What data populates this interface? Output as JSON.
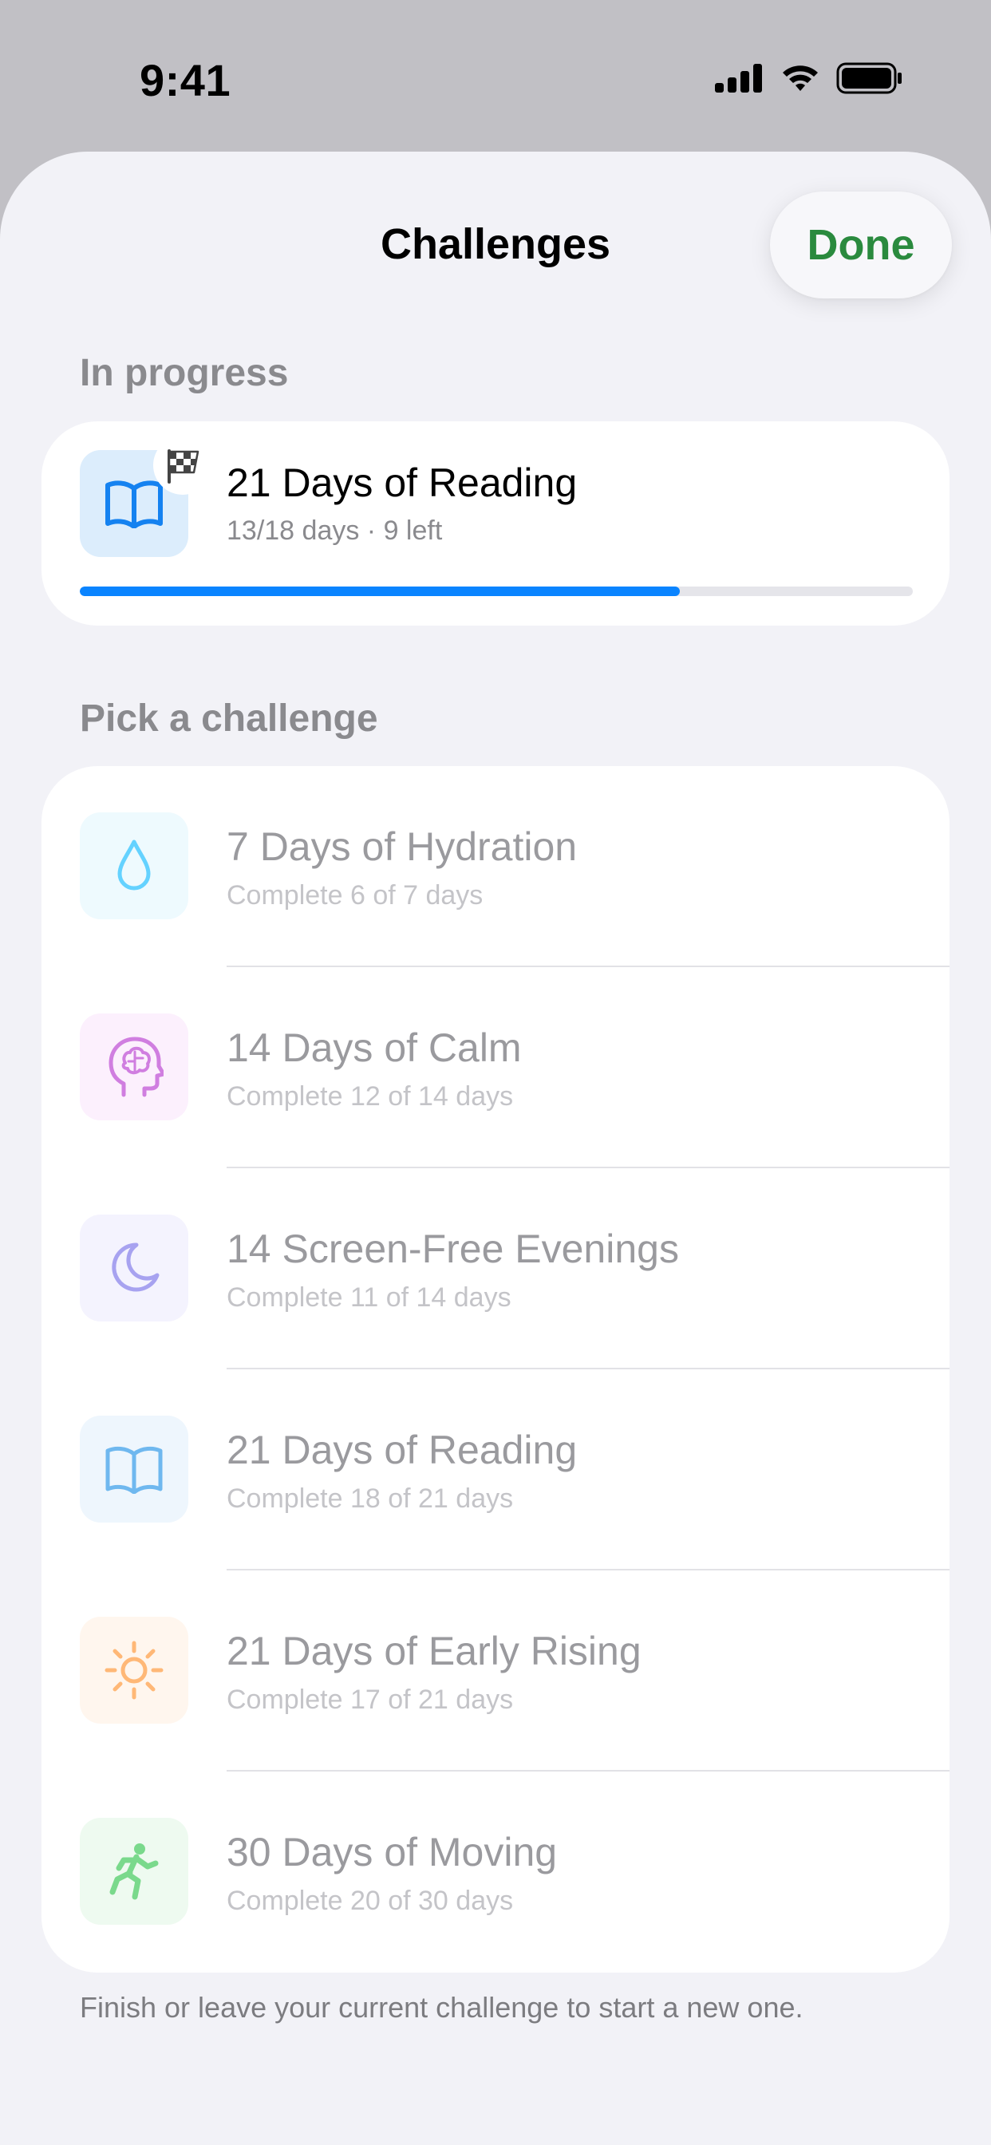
{
  "status_bar": {
    "time": "9:41"
  },
  "sheet": {
    "title": "Challenges",
    "done_label": "Done"
  },
  "in_progress": {
    "header": "In progress",
    "challenge": {
      "title": "21 Days of Reading",
      "subtitle": "13/18 days · 9 left",
      "progress_fraction": 0.72,
      "icon": "book-icon",
      "badge_icon": "checkered-flag-icon"
    }
  },
  "pick": {
    "header": "Pick a challenge",
    "items": [
      {
        "title": "7 Days of Hydration",
        "subtitle": "Complete 6 of 7 days",
        "icon": "water-drop-icon",
        "color": "#64d2ff"
      },
      {
        "title": "14 Days of Calm",
        "subtitle": "Complete 12 of 14 days",
        "icon": "brain-head-icon",
        "color": "#d07ee0"
      },
      {
        "title": "14 Screen-Free Evenings",
        "subtitle": "Complete 11 of 14 days",
        "icon": "moon-icon",
        "color": "#a7a2f0"
      },
      {
        "title": "21 Days of Reading",
        "subtitle": "Complete 18 of 21 days",
        "icon": "book-icon",
        "color": "#6fb8ef"
      },
      {
        "title": "21 Days of Early Rising",
        "subtitle": "Complete 17 of 21 days",
        "icon": "sun-icon",
        "color": "#ffb877"
      },
      {
        "title": "30 Days of Moving",
        "subtitle": "Complete 20 of 30 days",
        "icon": "running-figure-icon",
        "color": "#7ad98c"
      }
    ]
  },
  "footer": "Finish or leave your current challenge to start a new one.",
  "colors": {
    "accent_green": "#2a8a3e",
    "progress_blue": "#0a84ff",
    "sheet_bg": "#f2f2f7"
  }
}
